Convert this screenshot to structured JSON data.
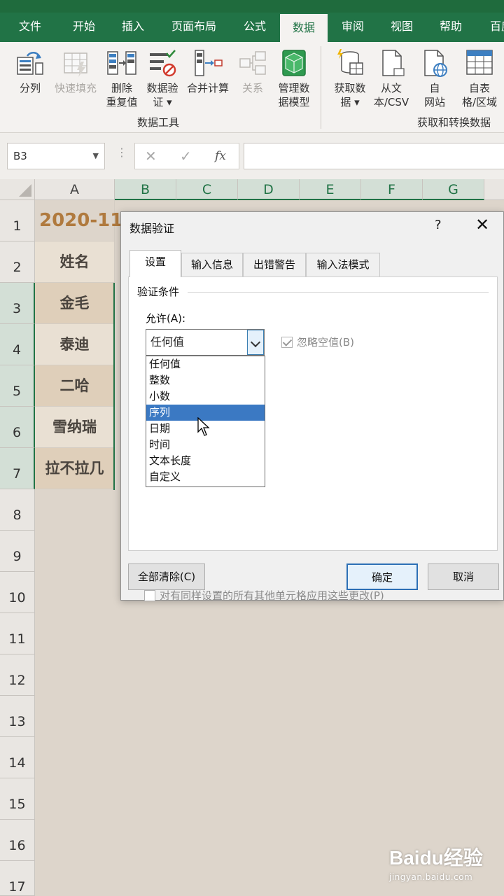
{
  "ribbon": {
    "tabs": [
      {
        "label": "文件"
      },
      {
        "label": "开始"
      },
      {
        "label": "插入"
      },
      {
        "label": "页面布局"
      },
      {
        "label": "公式"
      },
      {
        "label": "数据"
      },
      {
        "label": "审阅"
      },
      {
        "label": "视图"
      },
      {
        "label": "帮助"
      },
      {
        "label": "百度"
      }
    ],
    "active_tab": "数据",
    "buttons": [
      {
        "label": "分列",
        "icon": "text-to-columns-icon"
      },
      {
        "label": "快速填充",
        "icon": "flash-fill-icon",
        "disabled": true
      },
      {
        "label": "删除\n重复值",
        "icon": "remove-duplicates-icon"
      },
      {
        "label": "数据验\n证 ▾",
        "icon": "data-validation-icon"
      },
      {
        "label": "合并计算",
        "icon": "consolidate-icon"
      },
      {
        "label": "关系",
        "icon": "relationships-icon",
        "disabled": true
      },
      {
        "label": "管理数\n据模型",
        "icon": "data-model-icon"
      },
      {
        "label": "获取数\n据 ▾",
        "icon": "get-data-icon"
      },
      {
        "label": "从文\n本/CSV",
        "icon": "from-text-icon"
      },
      {
        "label": "自\n网站",
        "icon": "from-web-icon"
      },
      {
        "label": "自表\n格/区域",
        "icon": "from-table-icon"
      }
    ],
    "group_labels": {
      "data_tools": "数据工具",
      "get_transform": "获取和转换数据"
    }
  },
  "formula_bar": {
    "name_box": "B3",
    "fx": "fx",
    "cancel": "✕",
    "enter": "✓"
  },
  "sheet": {
    "columns": [
      "A",
      "B",
      "C",
      "D",
      "E",
      "F",
      "G"
    ],
    "rows": [
      "1",
      "2",
      "3",
      "4",
      "5",
      "6",
      "7",
      "8",
      "9",
      "10",
      "11",
      "12",
      "13",
      "14",
      "15",
      "16",
      "17"
    ],
    "a1": "2020-11",
    "names": [
      "姓名",
      "金毛",
      "泰迪",
      "二哈",
      "雪纳瑞",
      "拉不拉几"
    ]
  },
  "dialog": {
    "title": "数据验证",
    "help": "?",
    "close": "✕",
    "tabs": [
      "设置",
      "输入信息",
      "出错警告",
      "输入法模式"
    ],
    "section": "验证条件",
    "allow_label": "允许(A):",
    "allow_value": "任何值",
    "ignore_blank": "忽略空值(B)",
    "options": [
      "任何值",
      "整数",
      "小数",
      "序列",
      "日期",
      "时间",
      "文本长度",
      "自定义"
    ],
    "highlighted_option": "序列",
    "apply_all": "对有同样设置的所有其他单元格应用这些更改(P)",
    "clear_all": "全部清除(C)",
    "ok": "确定",
    "cancel": "取消"
  },
  "watermark": {
    "brand": "Baidu经验",
    "url": "jingyan.baidu.com"
  },
  "colors": {
    "excel_green": "#217346",
    "highlight_blue": "#3b79c3",
    "title_orange": "#b07a3e"
  }
}
